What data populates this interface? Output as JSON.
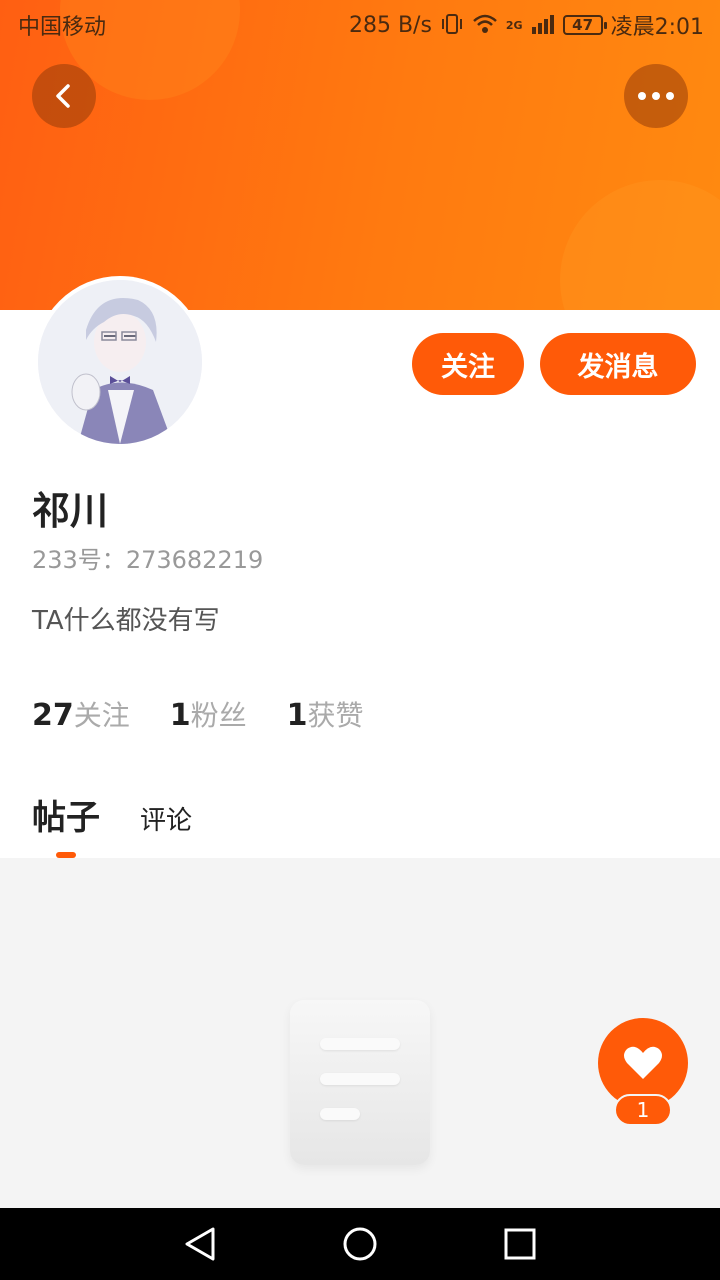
{
  "status_bar": {
    "carrier": "中国移动",
    "speed": "285 B/s",
    "network": "2G",
    "battery": "47",
    "time": "凌晨2:01"
  },
  "profile": {
    "name": "祁川",
    "uid_label": "233号：",
    "uid": "273682219",
    "bio": "TA什么都没有写",
    "follow_button": "关注",
    "message_button": "发消息"
  },
  "stats": [
    {
      "num": "27",
      "label": "关注"
    },
    {
      "num": "1",
      "label": "粉丝"
    },
    {
      "num": "1",
      "label": "获赞"
    }
  ],
  "tabs": {
    "posts": "帖子",
    "comments": "评论",
    "active": "posts"
  },
  "like": {
    "count": "1"
  },
  "colors": {
    "accent": "#ff5a08",
    "header_gradient_start": "#ff5f12",
    "header_gradient_end": "#ff8a10",
    "empty_bg": "#f4f4f4"
  },
  "icons": {
    "back": "chevron-left-icon",
    "more": "more-horizontal-icon",
    "like": "heart-icon",
    "nav_back": "triangle-back-icon",
    "nav_home": "circle-home-icon",
    "nav_recent": "square-recent-icon"
  }
}
